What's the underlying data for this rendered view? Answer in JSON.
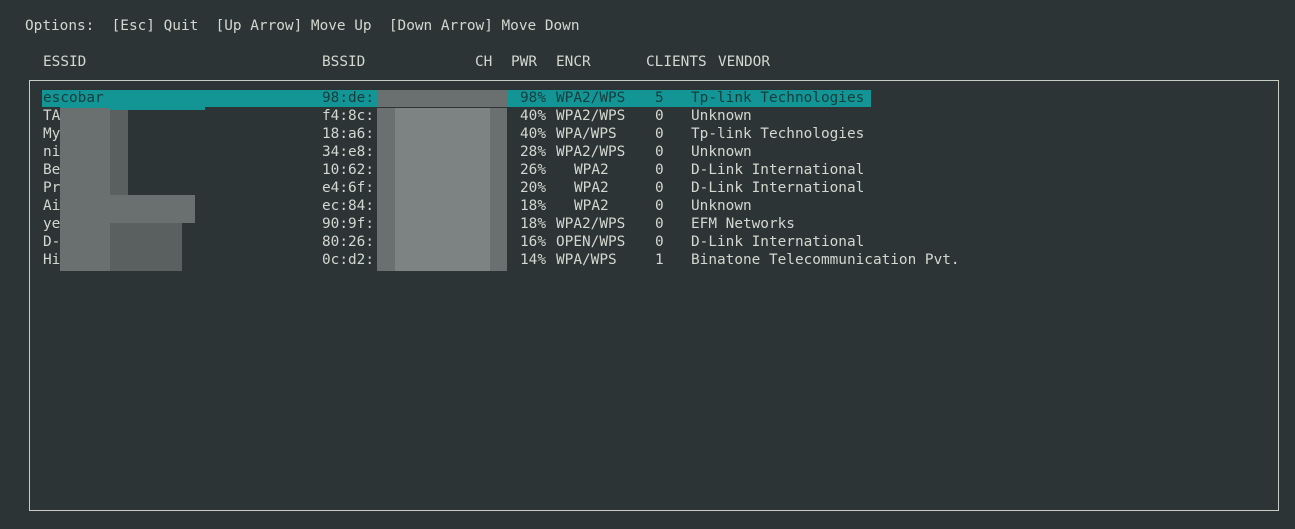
{
  "options": {
    "label": "Options:",
    "quit": "[Esc] Quit",
    "up": "[Up Arrow] Move Up",
    "down": "[Down Arrow] Move Down"
  },
  "columns": {
    "essid": "ESSID",
    "bssid": "BSSID",
    "ch": "CH",
    "pwr": "PWR",
    "encr": "ENCR",
    "clients": "CLIENTS",
    "vendor": "VENDOR"
  },
  "rows": [
    {
      "essid": "escobar",
      "bssid": "98:de:",
      "pwr": "98%",
      "encr": "WPA2/WPS",
      "clients": "5",
      "vendor": "Tp-link Technologies",
      "selected": true
    },
    {
      "essid": "TA",
      "bssid": "f4:8c:",
      "pwr": "40%",
      "encr": "WPA2/WPS",
      "clients": "0",
      "vendor": "Unknown"
    },
    {
      "essid": "My",
      "bssid": "18:a6:",
      "pwr": "40%",
      "encr": "WPA/WPS",
      "clients": "0",
      "vendor": "Tp-link Technologies"
    },
    {
      "essid": "ni",
      "bssid": "34:e8:",
      "pwr": "28%",
      "encr": "WPA2/WPS",
      "clients": "0",
      "vendor": "Unknown"
    },
    {
      "essid": "Be",
      "bssid": "10:62:",
      "pwr": "26%",
      "encr": "WPA2",
      "clients": "0",
      "vendor": "D-Link International"
    },
    {
      "essid": "Pr",
      "bssid": "e4:6f:",
      "pwr": "20%",
      "encr": "WPA2",
      "clients": "0",
      "vendor": "D-Link International"
    },
    {
      "essid": "Ai",
      "bssid": "ec:84:",
      "pwr": "18%",
      "encr": "WPA2",
      "clients": "0",
      "vendor": "Unknown"
    },
    {
      "essid": "ye",
      "bssid": "90:9f:",
      "pwr": "18%",
      "encr": "WPA2/WPS",
      "clients": "0",
      "vendor": "EFM Networks"
    },
    {
      "essid": "D-",
      "bssid": "80:26:",
      "pwr": "16%",
      "encr": "OPEN/WPS",
      "clients": "0",
      "vendor": "D-Link International"
    },
    {
      "essid": "Hi",
      "bssid": "0c:d2:",
      "pwr": "14%",
      "encr": "WPA/WPS",
      "clients": "1",
      "vendor": "Binatone Telecommunication Pvt."
    }
  ],
  "colors": {
    "background": "#2d3436",
    "text": "#d3d7cf",
    "selection": "#149595",
    "selection_text": "#163d3d",
    "border": "#c8ccc4"
  }
}
